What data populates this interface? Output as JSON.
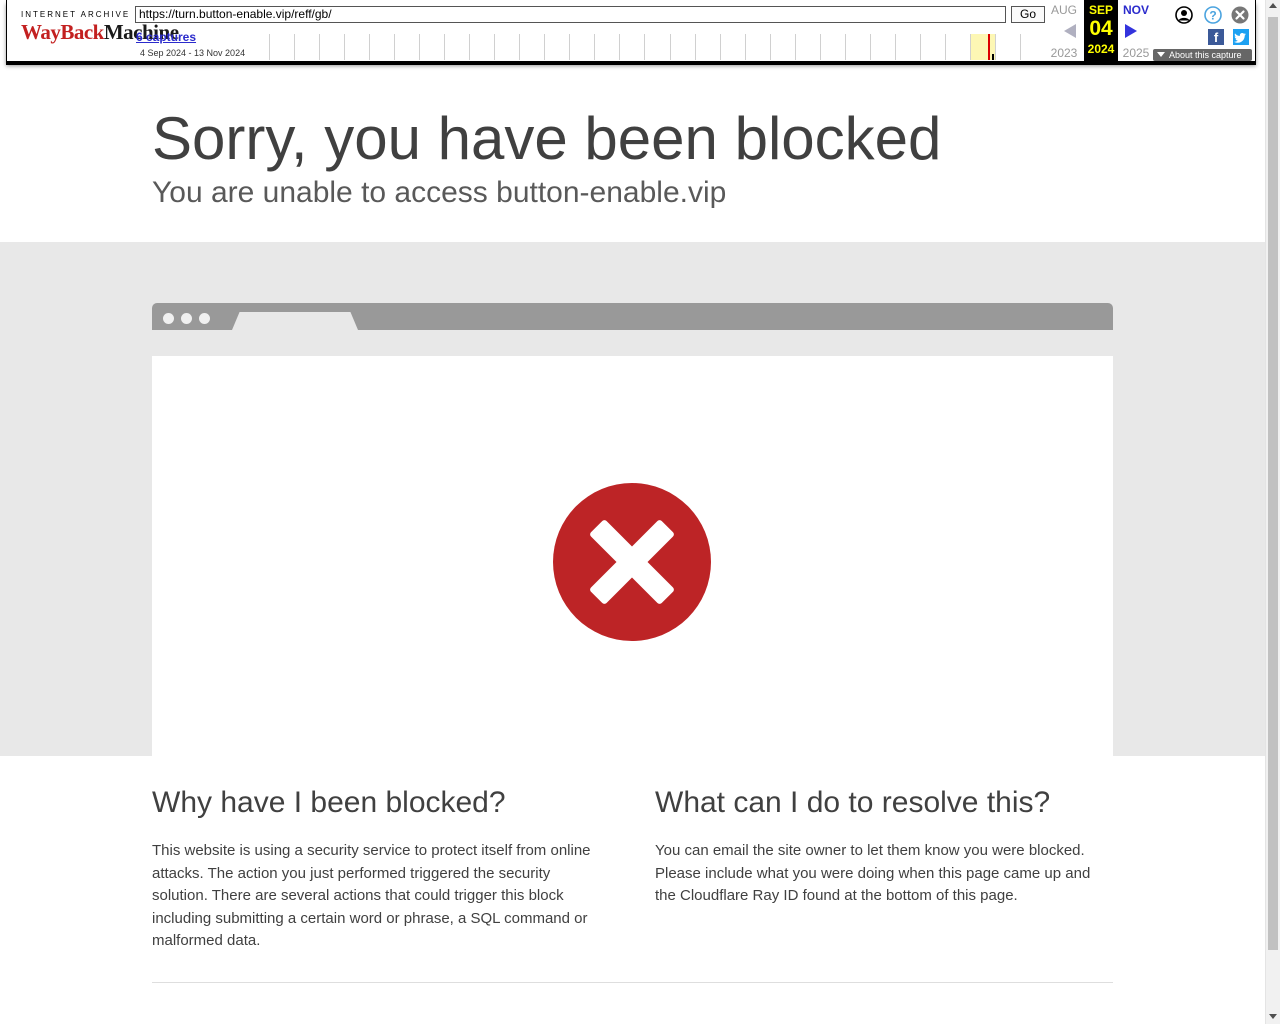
{
  "wayback": {
    "logo_top": "INTERNET ARCHIVE",
    "logo_wayback": "WayBack",
    "logo_machine": "Machine",
    "url": "https://turn.button-enable.vip/reff/gb/",
    "go_label": "Go",
    "captures_link": "6 captures",
    "captures_range": "4 Sep 2024 - 13 Nov 2024",
    "prev_month": "AUG",
    "prev_year": "2023",
    "current_month": "SEP",
    "current_day": "04",
    "current_year": "2024",
    "next_month": "NOV",
    "next_year": "2025",
    "about_capture": "About this capture",
    "facebook_letter": "f",
    "accent_color": "#ffff00",
    "link_color": "#2b2bcc"
  },
  "page": {
    "title": "Sorry, you have been blocked",
    "subtitle": "You are unable to access button-enable.vip",
    "why_title": "Why have I been blocked?",
    "why_text": "This website is using a security service to protect itself from online attacks. The action you just performed triggered the security solution. There are several actions that could trigger this block including submitting a certain word or phrase, a SQL command or malformed data.",
    "what_title": "What can I do to resolve this?",
    "what_text": "You can email the site owner to let them know you were blocked. Please include what you were doing when this page came up and the Cloudflare Ray ID found at the bottom of this page.",
    "error_color": "#bd2426"
  }
}
